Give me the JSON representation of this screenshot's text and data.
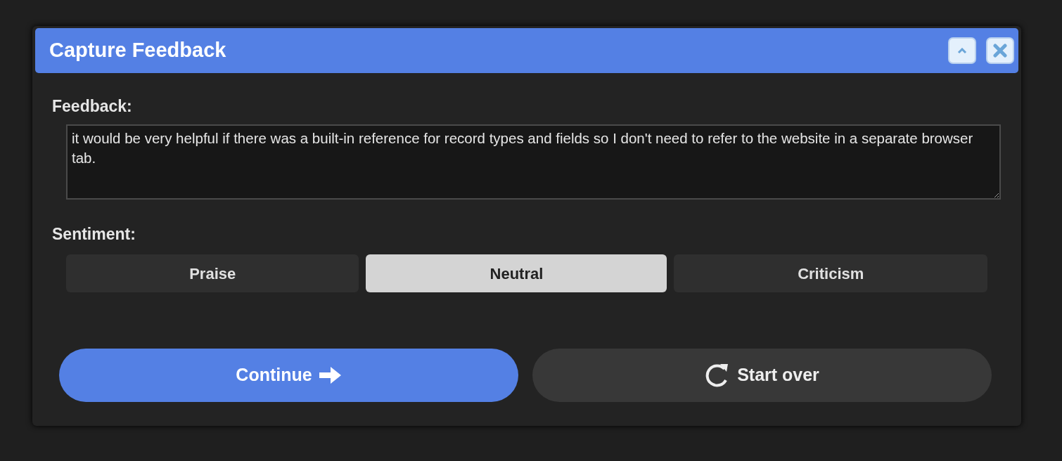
{
  "dialog": {
    "title": "Capture Feedback"
  },
  "feedback": {
    "label": "Feedback:",
    "value": "it would be very helpful if there was a built-in reference for record types and fields so I don't need to refer to the website in a separate browser tab."
  },
  "sentiment": {
    "label": "Sentiment:",
    "options": [
      {
        "label": "Praise",
        "selected": false
      },
      {
        "label": "Neutral",
        "selected": true
      },
      {
        "label": "Criticism",
        "selected": false
      }
    ]
  },
  "actions": [
    {
      "label": "Continue",
      "kind": "primary"
    },
    {
      "label": "Start over",
      "kind": "secondary"
    }
  ]
}
